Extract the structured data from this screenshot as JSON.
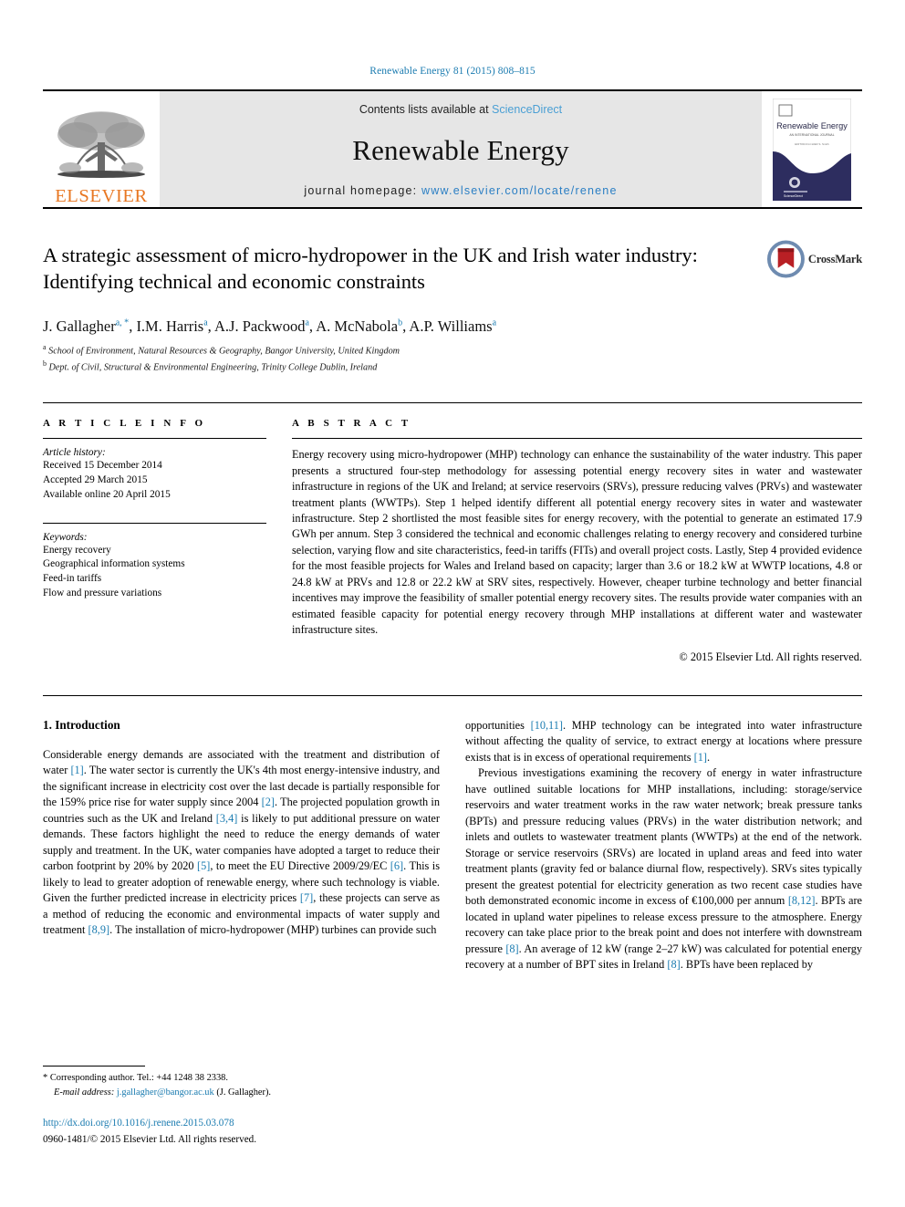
{
  "running_head": "Renewable Energy 81 (2015) 808–815",
  "masthead": {
    "publisher_name": "ELSEVIER",
    "contents_prefix": "Contents lists available at ",
    "contents_link": "ScienceDirect",
    "journal_name": "Renewable Energy",
    "homepage_prefix": "journal homepage: ",
    "homepage_url": "www.elsevier.com/locate/renene",
    "cover": {
      "title": "Renewable Energy",
      "subtitle": "AN INTERNATIONAL JOURNAL"
    }
  },
  "article": {
    "title": "A strategic assessment of micro-hydropower in the UK and Irish water industry: Identifying technical and economic constraints",
    "crossmark_label": "CrossMark",
    "authors": [
      {
        "name": "J. Gallagher",
        "marks": "a, *"
      },
      {
        "name": "I.M. Harris",
        "marks": "a"
      },
      {
        "name": "A.J. Packwood",
        "marks": "a"
      },
      {
        "name": "A. McNabola",
        "marks": "b"
      },
      {
        "name": "A.P. Williams",
        "marks": "a"
      }
    ],
    "affiliations": [
      {
        "mark": "a",
        "text": "School of Environment, Natural Resources & Geography, Bangor University, United Kingdom"
      },
      {
        "mark": "b",
        "text": "Dept. of Civil, Structural & Environmental Engineering, Trinity College Dublin, Ireland"
      }
    ]
  },
  "article_info": {
    "heading": "A R T I C L E   I N F O",
    "history_label": "Article history:",
    "history": [
      "Received 15 December 2014",
      "Accepted 29 March 2015",
      "Available online 20 April 2015"
    ],
    "keywords_label": "Keywords:",
    "keywords": [
      "Energy recovery",
      "Geographical information systems",
      "Feed-in tariffs",
      "Flow and pressure variations"
    ]
  },
  "abstract": {
    "heading": "A B S T R A C T",
    "text": "Energy recovery using micro-hydropower (MHP) technology can enhance the sustainability of the water industry. This paper presents a structured four-step methodology for assessing potential energy recovery sites in water and wastewater infrastructure in regions of the UK and Ireland; at service reservoirs (SRVs), pressure reducing valves (PRVs) and wastewater treatment plants (WWTPs). Step 1 helped identify different all potential energy recovery sites in water and wastewater infrastructure. Step 2 shortlisted the most feasible sites for energy recovery, with the potential to generate an estimated 17.9 GWh per annum. Step 3 considered the technical and economic challenges relating to energy recovery and considered turbine selection, varying flow and site characteristics, feed-in tariffs (FITs) and overall project costs. Lastly, Step 4 provided evidence for the most feasible projects for Wales and Ireland based on capacity; larger than 3.6 or 18.2 kW at WWTP locations, 4.8 or 24.8 kW at PRVs and 12.8 or 22.2 kW at SRV sites, respectively. However, cheaper turbine technology and better financial incentives may improve the feasibility of smaller potential energy recovery sites. The results provide water companies with an estimated feasible capacity for potential energy recovery through MHP installations at different water and wastewater infrastructure sites.",
    "copyright": "© 2015 Elsevier Ltd. All rights reserved."
  },
  "body": {
    "section_heading": "1. Introduction",
    "left_paragraphs": [
      "Considerable energy demands are associated with the treatment and distribution of water [1]. The water sector is currently the UK's 4th most energy-intensive industry, and the significant increase in electricity cost over the last decade is partially responsible for the 159% price rise for water supply since 2004 [2]. The projected population growth in countries such as the UK and Ireland [3,4] is likely to put additional pressure on water demands. These factors highlight the need to reduce the energy demands of water supply and treatment. In the UK, water companies have adopted a target to reduce their carbon footprint by 20% by 2020 [5], to meet the EU Directive 2009/29/EC [6]. This is likely to lead to greater adoption of renewable energy, where such technology is viable. Given the further predicted increase in electricity prices [7], these projects can serve as a method of reducing the economic and environmental impacts of water supply and treatment [8,9]. The installation of micro-hydropower (MHP) turbines can provide such"
    ],
    "right_paragraphs": [
      "opportunities [10,11]. MHP technology can be integrated into water infrastructure without affecting the quality of service, to extract energy at locations where pressure exists that is in excess of operational requirements [1].",
      "Previous investigations examining the recovery of energy in water infrastructure have outlined suitable locations for MHP installations, including: storage/service reservoirs and water treatment works in the raw water network; break pressure tanks (BPTs) and pressure reducing values (PRVs) in the water distribution network; and inlets and outlets to wastewater treatment plants (WWTPs) at the end of the network. Storage or service reservoirs (SRVs) are located in upland areas and feed into water treatment plants (gravity fed or balance diurnal flow, respectively). SRVs sites typically present the greatest potential for electricity generation as two recent case studies have both demonstrated economic income in excess of €100,000 per annum [8,12]. BPTs are located in upland water pipelines to release excess pressure to the atmosphere. Energy recovery can take place prior to the break point and does not interfere with downstream pressure [8]. An average of 12 kW (range 2–27 kW) was calculated for potential energy recovery at a number of BPT sites in Ireland [8]. BPTs have been replaced by"
    ]
  },
  "footnotes": {
    "corresponding_marker": "*",
    "corresponding_text": "Corresponding author. Tel.: +44 1248 38 2338.",
    "email_label": "E-mail address:",
    "email_address": "j.gallagher@bangor.ac.uk",
    "email_owner": "(J. Gallagher).",
    "doi_url": "http://dx.doi.org/10.1016/j.renene.2015.03.078",
    "issn_line": "0960-1481/© 2015 Elsevier Ltd. All rights reserved."
  },
  "colors": {
    "link_blue": "#1a7bb0",
    "elsevier_orange": "#E87722",
    "sd_blue": "#4a9fd4",
    "banner_grey": "#e6e6e6",
    "cover_navy": "#2d2d5f",
    "cover_gold": "#c9a227",
    "crossmark_red": "#b92025"
  }
}
